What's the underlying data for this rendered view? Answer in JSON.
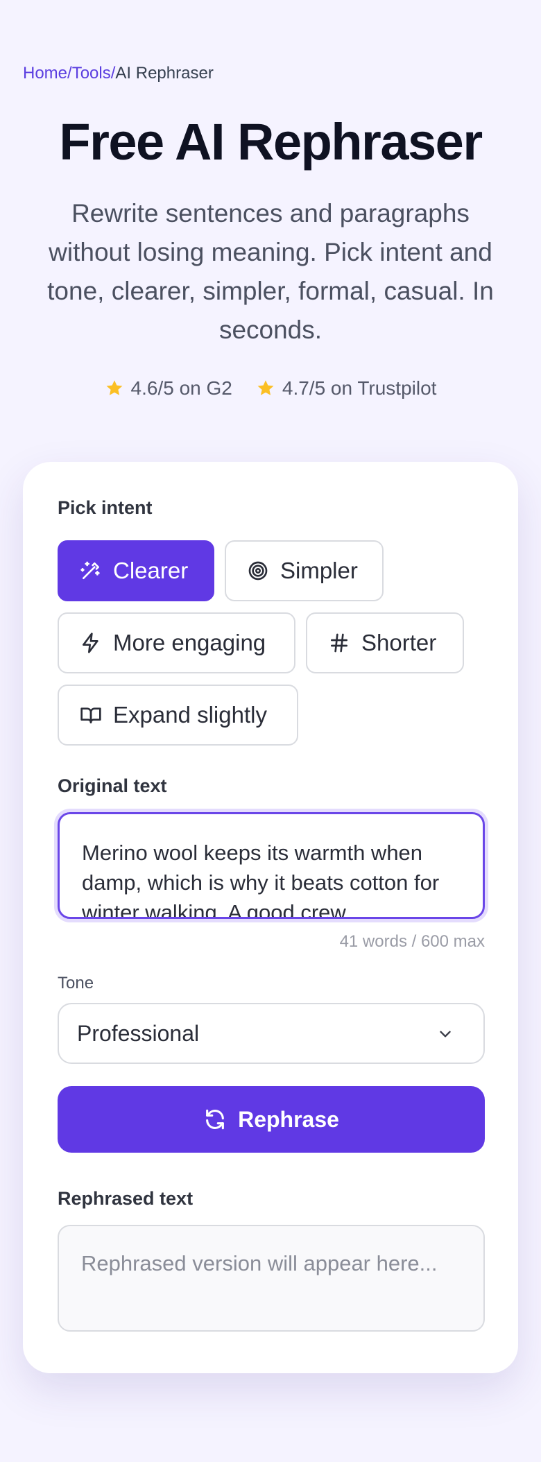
{
  "breadcrumb": {
    "home": "Home",
    "tools": "Tools",
    "current": "AI Rephraser",
    "separator": "/"
  },
  "hero": {
    "title": "Free AI Rephraser",
    "subtitle": "Rewrite sentences and paragraphs without losing meaning. Pick intent and tone, clearer, simpler, formal, casual. In seconds."
  },
  "ratings": [
    {
      "text": "4.6/5 on G2",
      "icon": "star-icon"
    },
    {
      "text": "4.7/5 on Trustpilot",
      "icon": "star-icon"
    }
  ],
  "intent": {
    "label": "Pick intent",
    "options": [
      {
        "label": "Clearer",
        "icon": "magic-wand-icon",
        "selected": true
      },
      {
        "label": "Simpler",
        "icon": "target-icon",
        "selected": false
      },
      {
        "label": "More engaging",
        "icon": "lightning-icon",
        "selected": false
      },
      {
        "label": "Shorter",
        "icon": "hash-icon",
        "selected": false
      },
      {
        "label": "Expand slightly",
        "icon": "book-icon",
        "selected": false
      }
    ]
  },
  "original": {
    "label": "Original text",
    "value": "Merino wool keeps its warmth when damp, which is why it beats cotton for winter walking. A good crew",
    "count": "41 words / 600 max"
  },
  "tone": {
    "label": "Tone",
    "selected": "Professional"
  },
  "action": {
    "label": "Rephrase",
    "icon": "refresh-icon"
  },
  "output": {
    "label": "Rephrased text",
    "placeholder": "Rephrased version will appear here..."
  },
  "colors": {
    "accent": "#6039e4",
    "star": "#fbbf24",
    "background": "#f5f3ff"
  }
}
